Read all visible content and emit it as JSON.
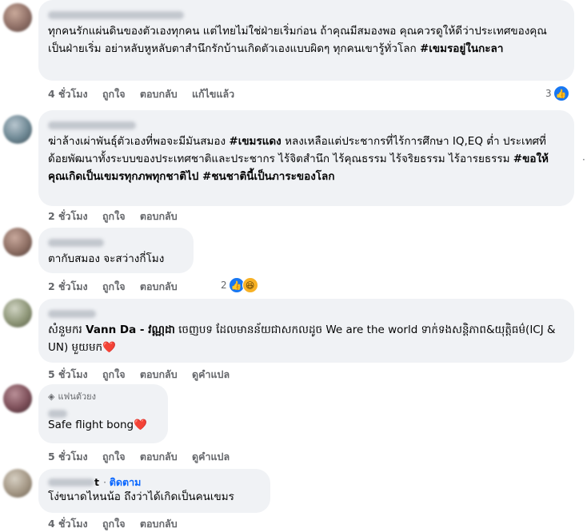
{
  "comments": [
    {
      "text_plain": "ทุกคนรักแผ่นดินของตัวเองทุกคน แต่ไทยไม่ใช่ฝ่ายเริ่มก่อน ถ้าคุณมีสมองพอ คุณควรดูให้ดีว่าประเทศของคุณเป็นฝ่ายเริ่ม อย่าหลับหูหลับตาสำนึกรักบ้านเกิดตัวเองแบบผิดๆ ทุกคนเขารู้ทั่วโลก",
      "hashtag": "#เขมรอยู่ในกะลา",
      "time": "4 ชั่วโมง",
      "like": "ถูกใจ",
      "reply": "ตอบกลับ",
      "extra": "แก้ไขแล้ว",
      "reaction_count": "3"
    },
    {
      "text_a": "ฆ่าล้างเผ่าพันธุ์ตัวเองที่พอจะมีมันสมอง ",
      "hashtag_a": "#เขมรแดง",
      "text_b": " หลงเหลือแต่ประชากรที่ไร้การศึกษา IQ,EQ ต่ำ ประเทศที่ด้อยพัฒนาทั้งระบบของประเทศชาติและประชากร ไร้จิตสำนึก ไร้คุณธรรม ไร้จริยธรรม ไร้อารยธรรม ",
      "hashtag_b": "#ขอให้คุณเกิดเป็นเขมรทุกภพทุกชาติไป #ชนชาตินี้เป็นภาระของโลก",
      "time": "2 ชั่วโมง",
      "like": "ถูกใจ",
      "reply": "ตอบกลับ"
    },
    {
      "text": "ตากับสมอง จะสว่างกี่โมง",
      "time": "2 ชั่วโมง",
      "like": "ถูกใจ",
      "reply": "ตอบกลับ",
      "reaction_count": "2"
    },
    {
      "text_a": "សំនួមករ ",
      "name_bold": "Vann Da - វណ្ណដា",
      "text_b": " ចេញបទ ដែលមានន័យជាសកលដូច We are the world ទាក់ទងសន្តិភាព&យុត្តិធម៌(ICJ & UN) មួយមក",
      "heart": "❤️",
      "time": "5 ชั่วโมง",
      "like": "ถูกใจ",
      "reply": "ตอบกลับ",
      "translate": "ดูคำแปล"
    },
    {
      "badge": "แฟนตัวยง",
      "text": "Safe flight bong",
      "heart": "❤️",
      "time": "5 ชั่วโมง",
      "like": "ถูกใจ",
      "reply": "ตอบกลับ",
      "translate": "ดูคำแปล"
    },
    {
      "author_suffix": "t",
      "follow": "ติดตาม",
      "text": "โง่ขนาดไหนน้อ ถึงว่าได้เกิดเป็นคนเขมร",
      "time": "4 ชั่วโมง",
      "like": "ถูกใจ",
      "reply": "ตอบกลับ"
    }
  ],
  "icons": {
    "like": "thumbs-up-icon",
    "haha": "haha-icon",
    "badge": "diamond-icon",
    "more": "more-dots-icon"
  },
  "colors": {
    "bubble": "#f0f2f5",
    "like_blue": "#1877f2",
    "follow_blue": "#0866ff",
    "meta_gray": "#65676b"
  }
}
